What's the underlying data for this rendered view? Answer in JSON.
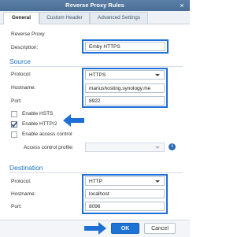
{
  "dialog": {
    "title": "Reverse Proxy Rules",
    "close_glyph": "×"
  },
  "tabs": [
    {
      "label": "General"
    },
    {
      "label": "Custom Header"
    },
    {
      "label": "Advanced Settings"
    }
  ],
  "reverse_proxy": {
    "heading": "Reverse Proxy",
    "description_label": "Description:",
    "description_value": "Emby HTTPS"
  },
  "source": {
    "heading": "Source",
    "protocol_label": "Protocol:",
    "protocol_value": "HTTPS",
    "hostname_label": "Hostname:",
    "hostname_value": "mariushosting.synology.me",
    "port_label": "Port:",
    "port_value": "8922",
    "hsts_label": "Enable HSTS",
    "hsts_checked": false,
    "http2_label": "Enable HTTP/2",
    "http2_checked": true,
    "access_control_label": "Enable access control",
    "access_control_checked": false,
    "access_profile_label": "Access control profile:",
    "access_profile_value": ""
  },
  "destination": {
    "heading": "Destination",
    "protocol_label": "Protocol:",
    "protocol_value": "HTTP",
    "hostname_label": "Hostname:",
    "hostname_value": "localhost",
    "port_label": "Port:",
    "port_value": "8096"
  },
  "footer": {
    "ok_label": "OK",
    "cancel_label": "Cancel"
  },
  "colors": {
    "accent": "#1e6fd8",
    "titlebar": "#4a6f97",
    "ok_button": "#1d73d6"
  }
}
